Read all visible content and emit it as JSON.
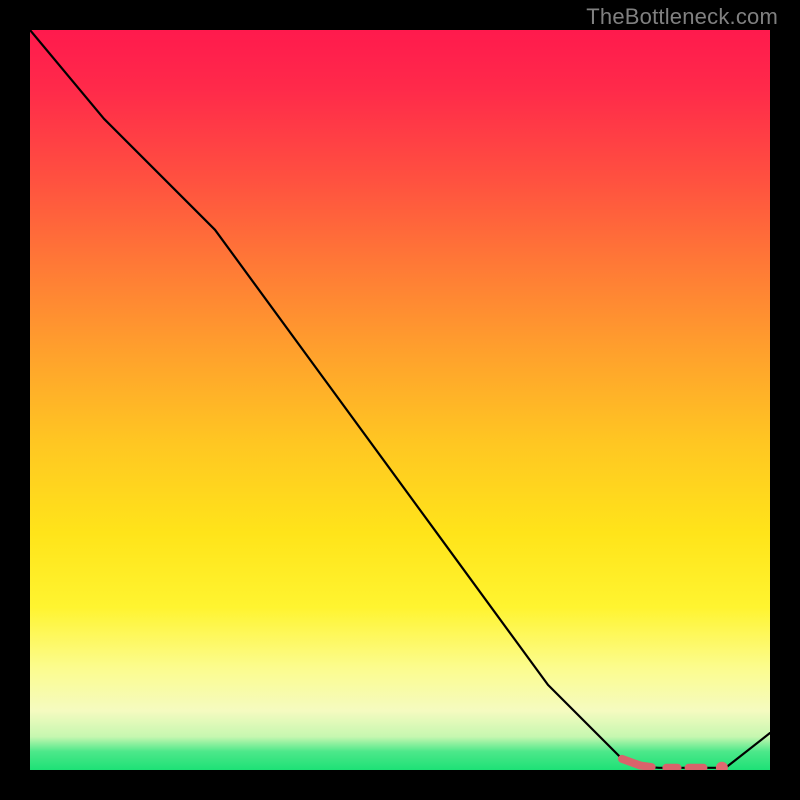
{
  "watermark": "TheBottleneck.com",
  "colors": {
    "frame": "#000000",
    "watermark_text": "#808080",
    "curve": "#000000",
    "flat_marker": "#d9636b",
    "gradient_top": "#ff1a4d",
    "gradient_mid": "#ffe41a",
    "gradient_bottom": "#1de176"
  },
  "chart_data": {
    "type": "line",
    "title": "",
    "xlabel": "",
    "ylabel": "",
    "xlim": [
      0,
      100
    ],
    "ylim": [
      0,
      100
    ],
    "grid": false,
    "legend": false,
    "series": [
      {
        "name": "bottleneck-curve",
        "x": [
          0,
          10,
          25,
          40,
          55,
          70,
          80,
          82,
          85,
          88,
          90,
          92,
          94,
          100
        ],
        "y": [
          100,
          88,
          73,
          52.5,
          32,
          11.5,
          1.5,
          0.5,
          0.3,
          0.3,
          0.3,
          0.3,
          0.3,
          5
        ]
      }
    ],
    "annotations": [
      {
        "name": "flat-minimum-marker",
        "style": "dashed-red",
        "x": [
          80,
          82.5,
          84,
          86,
          87.5,
          89,
          91,
          93.5
        ],
        "y": [
          1.5,
          0.6,
          0.4,
          0.3,
          0.3,
          0.3,
          0.3,
          0.3
        ]
      }
    ]
  }
}
